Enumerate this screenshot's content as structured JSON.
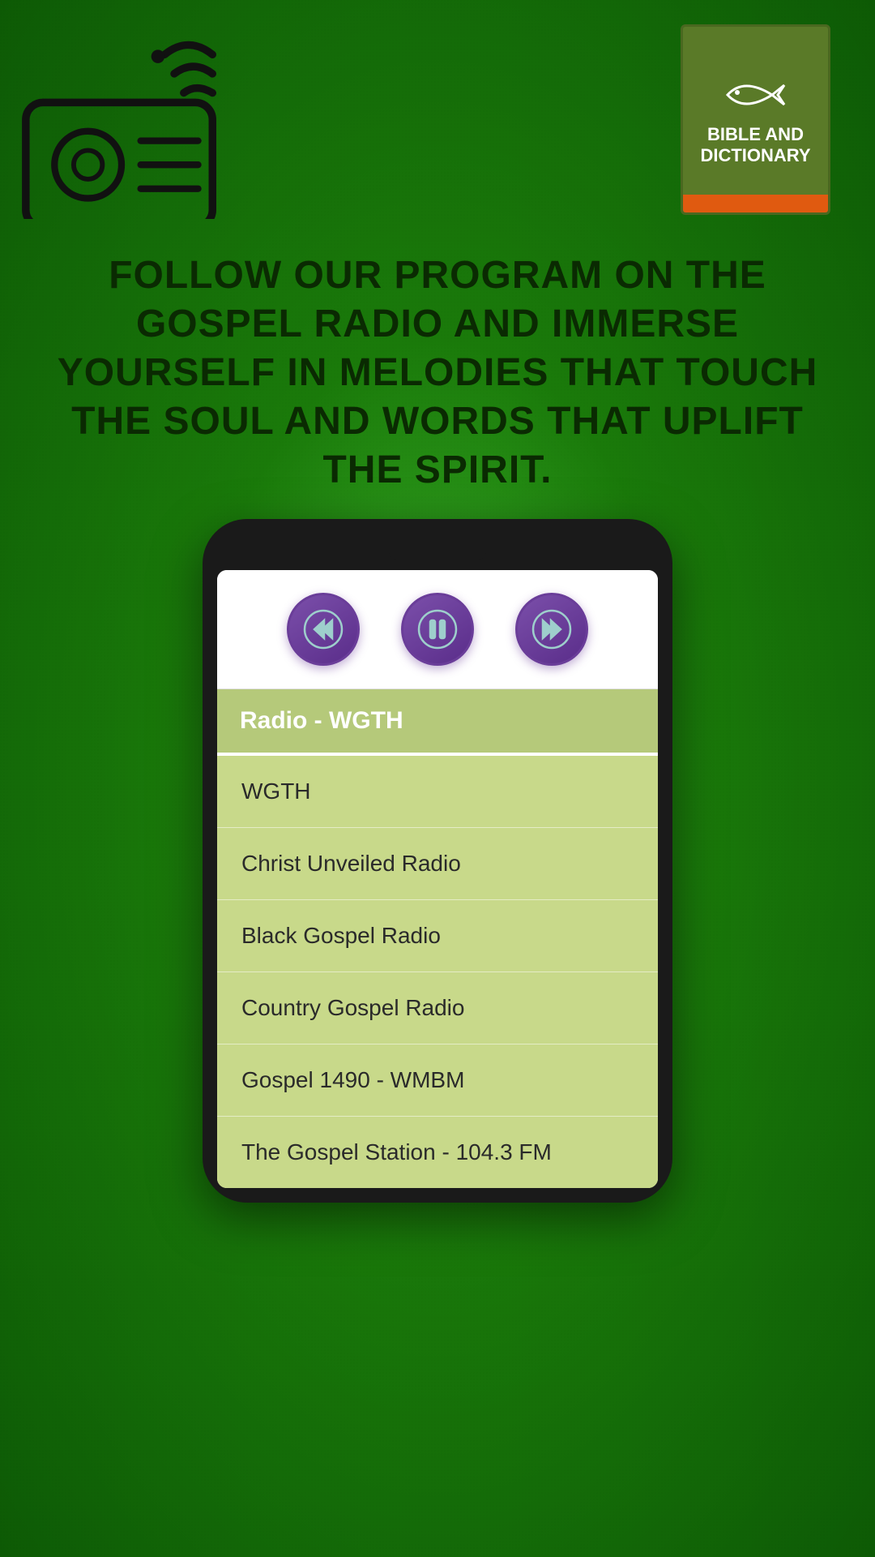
{
  "header": {
    "tagline": "FOLLOW OUR PROGRAM ON THE GOSPEL RADIO AND IMMERSE YOURSELF IN MELODIES THAT TOUCH THE SOUL AND WORDS THAT UPLIFT THE SPIRIT."
  },
  "bible_book": {
    "title_line1": "Bible and",
    "title_line2": "Dictionary"
  },
  "player": {
    "current_station": "Radio - WGTH",
    "rewind_label": "Rewind",
    "pause_label": "Pause",
    "fast_forward_label": "Fast Forward"
  },
  "radio_stations": [
    {
      "id": 1,
      "name": "WGTH"
    },
    {
      "id": 2,
      "name": "Christ Unveiled Radio"
    },
    {
      "id": 3,
      "name": "Black Gospel Radio"
    },
    {
      "id": 4,
      "name": "Country Gospel Radio"
    },
    {
      "id": 5,
      "name": "Gospel 1490 - WMBM"
    },
    {
      "id": 6,
      "name": "The Gospel Station - 104.3 FM"
    }
  ]
}
